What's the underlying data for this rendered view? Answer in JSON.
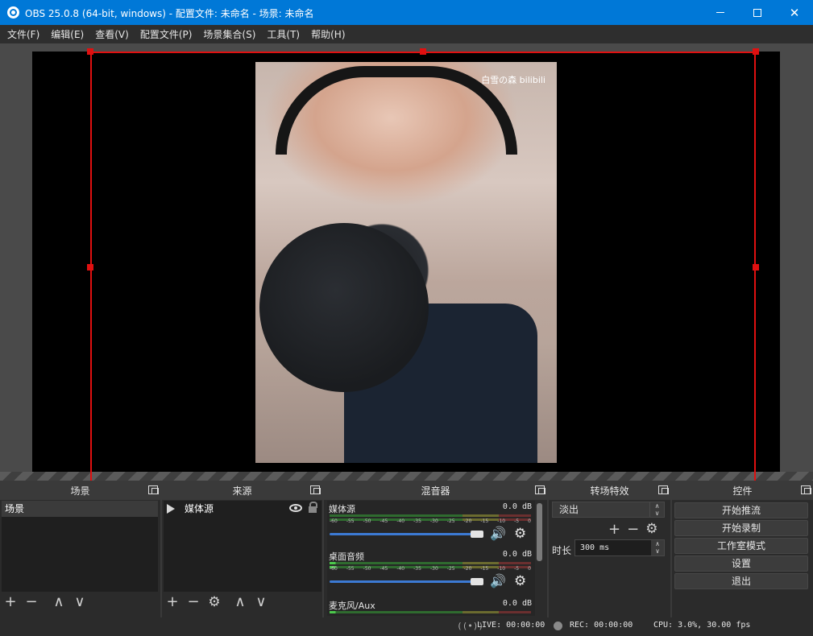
{
  "window": {
    "title": "OBS 25.0.8 (64-bit, windows) - 配置文件: 未命名 - 场景: 未命名",
    "minimize": "—",
    "maximize": "□",
    "close": "✕"
  },
  "menu": [
    "文件(F)",
    "编辑(E)",
    "查看(V)",
    "配置文件(P)",
    "场景集合(S)",
    "工具(T)",
    "帮助(H)"
  ],
  "preview": {
    "watermark": "白雪の森 bilibili"
  },
  "scenes": {
    "title": "场景",
    "items": [
      "场景"
    ]
  },
  "sources": {
    "title": "来源",
    "items": [
      "媒体源"
    ]
  },
  "mixer": {
    "title": "混音器",
    "ticks": [
      "-60",
      "-55",
      "-50",
      "-45",
      "-40",
      "-35",
      "-30",
      "-25",
      "-20",
      "-15",
      "-10",
      "-5",
      "0"
    ],
    "channels": [
      {
        "name": "媒体源",
        "db": "0.0 dB"
      },
      {
        "name": "桌面音频",
        "db": "0.0 dB"
      },
      {
        "name": "麦克风/Aux",
        "db": "0.0 dB"
      }
    ]
  },
  "transitions": {
    "title": "转场特效",
    "selected": "淡出",
    "duration_label": "时长",
    "duration_value": "300 ms"
  },
  "controls": {
    "title": "控件",
    "buttons": [
      "开始推流",
      "开始录制",
      "工作室模式",
      "设置",
      "退出"
    ]
  },
  "status": {
    "live": "LIVE: 00:00:00",
    "rec": "REC: 00:00:00",
    "cpu": "CPU: 3.0%, 30.00 fps"
  },
  "icons": {
    "add": "+",
    "remove": "−",
    "up": "∧",
    "down": "∨",
    "gear": "⚙",
    "volume": "🔊"
  },
  "colors": {
    "titlebar": "#0078d7",
    "selection": "#e01010",
    "volume_slider": "#3c7ad4"
  }
}
